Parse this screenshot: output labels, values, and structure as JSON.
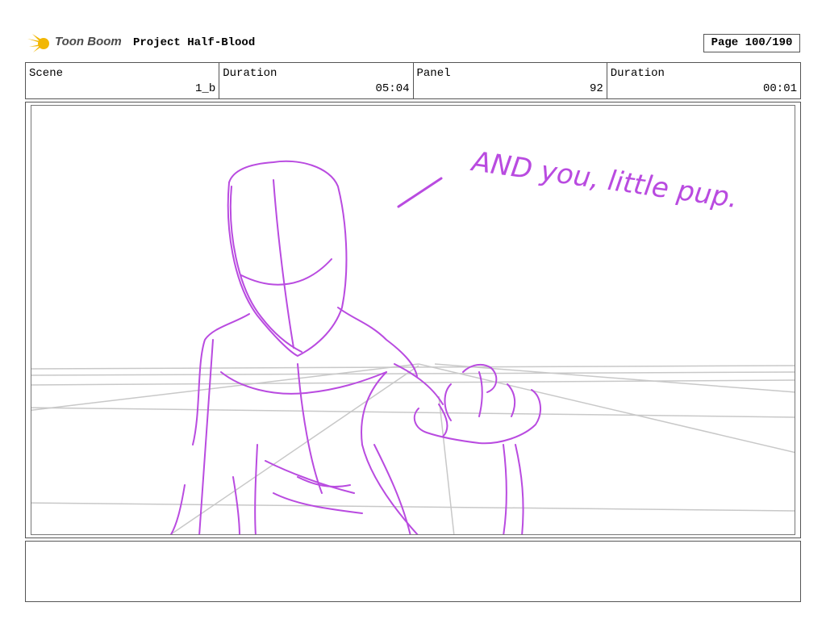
{
  "header": {
    "logo_text": "Toon Boom",
    "project_title": "Project Half-Blood",
    "page": "Page 100/190"
  },
  "info": {
    "scene_label": "Scene",
    "scene_value": "1_b",
    "scene_duration_label": "Duration",
    "scene_duration_value": "05:04",
    "panel_label": "Panel",
    "panel_value": "92",
    "panel_duration_label": "Duration",
    "panel_duration_value": "00:01"
  },
  "drawing": {
    "dialogue": "AND you, little pup.",
    "stroke_color": "#b94be0",
    "guide_color": "#c8c8c8"
  },
  "notes": {
    "text": ""
  }
}
